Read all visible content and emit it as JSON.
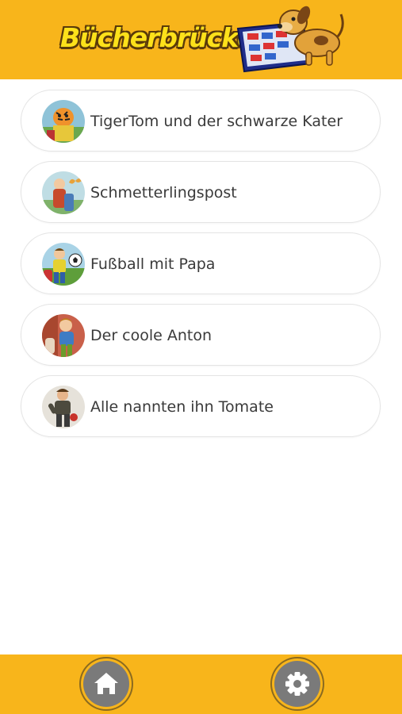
{
  "header": {
    "logo_text": "Bücherbrücken",
    "colors": {
      "bar": "#f8b51b",
      "logo_fill": "#fde11a"
    }
  },
  "books": [
    {
      "title": "TigerTom und der schwarze Kater",
      "thumb": "tiger-cover"
    },
    {
      "title": "Schmetterlingspost",
      "thumb": "butterfly-cover"
    },
    {
      "title": "Fußball mit Papa",
      "thumb": "football-cover"
    },
    {
      "title": "Der coole Anton",
      "thumb": "anton-cover"
    },
    {
      "title": "Alle nannten ihn Tomate",
      "thumb": "tomato-cover"
    }
  ],
  "footer": {
    "home_icon": "home-icon",
    "settings_icon": "gear-icon",
    "colors": {
      "button": "#7a7a7a"
    }
  }
}
